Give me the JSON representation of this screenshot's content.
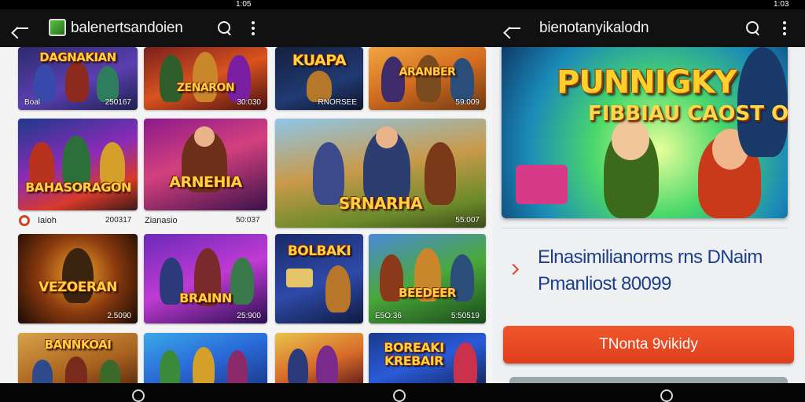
{
  "status_bars": {
    "left_time": "1:05",
    "right_time": "1:03"
  },
  "left_app": {
    "title": "balenertsandoien",
    "back_icon": "back-arrow-icon",
    "app_icon": "app-logo-icon",
    "search_icon": "search-icon",
    "more_icon": "more-vert-icon"
  },
  "right_app": {
    "title": "bienotanyikalodn",
    "back_icon": "back-arrow-icon",
    "search_icon": "search-icon",
    "more_icon": "more-vert-icon"
  },
  "tiles": [
    {
      "title": "DAGNAKIAN",
      "meta_left": "Boal",
      "meta_right": "250167"
    },
    {
      "title": "ZENARON",
      "meta_left": "",
      "meta_right": "30:030"
    },
    {
      "title": "KUAPA",
      "meta_left": "",
      "meta_right": "RNORSEE"
    },
    {
      "title": "ARANBER",
      "meta_left": "",
      "meta_right": "59:009"
    },
    {
      "title": "BAHASORAGON",
      "meta_left": "",
      "meta_right": ""
    },
    {
      "title": "ARNEHIA",
      "meta_left": "",
      "meta_right": ""
    },
    {
      "title": "SRNARHA",
      "meta_left": "",
      "meta_right": "55:007"
    },
    {
      "title": "VEZOERAN",
      "meta_left": "",
      "meta_right": "2.5090"
    },
    {
      "title": "BRAINN",
      "meta_left": "",
      "meta_right": "25:900"
    },
    {
      "title": "BOLBAKI",
      "meta_left": "",
      "meta_right": ""
    },
    {
      "title": "BEEDEER",
      "meta_left": "E5O:36",
      "meta_right": "5:50519"
    },
    {
      "title": "BANNKOAI",
      "meta_left": "",
      "meta_right": ""
    },
    {
      "title": "",
      "meta_left": "",
      "meta_right": ""
    },
    {
      "title": "",
      "meta_left": "",
      "meta_right": ""
    },
    {
      "title": "BOREAKI KREBAIR",
      "meta_left": "",
      "meta_right": ""
    }
  ],
  "row2_labels": {
    "left_name": "Iaioh",
    "left_count": "200317",
    "mid_name": "Zianasio",
    "mid_count": "50:037"
  },
  "detail": {
    "banner_title": "PUNNIGKY",
    "banner_subtitle": "FIBBIAU CAOST OIS",
    "description_line1": "Elnasimilianorms rns DNaim",
    "description_line2": "Pmanliost 80099",
    "cta_label": "TNonta 9vikidy",
    "chevron_icon": "chevron-right-icon"
  },
  "nav": {
    "home_icon": "home-circle-icon"
  },
  "colors": {
    "accent": "#e9492a",
    "desc_text": "#1d3f8a",
    "bar": "#111111"
  }
}
